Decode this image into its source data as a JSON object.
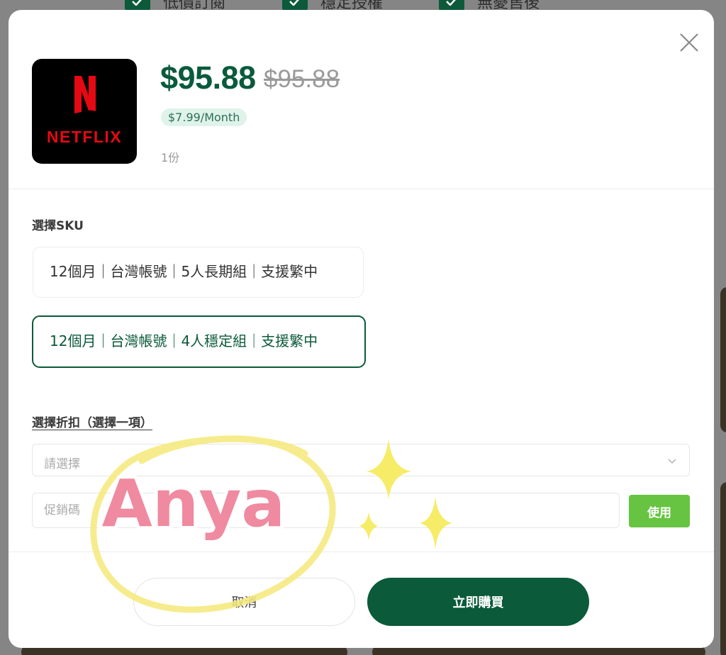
{
  "background": {
    "features": [
      "低價訂閱",
      "穩定授權",
      "無憂售後"
    ]
  },
  "product": {
    "logo_text": "NETFLIX",
    "price": "$95.88",
    "original_price": "$95.88",
    "monthly_price": "$7.99/Month",
    "quantity": "1份"
  },
  "sku": {
    "label": "選擇SKU",
    "options": [
      {
        "label": "12個月｜台灣帳號｜5人長期組｜支援繁中",
        "selected": false
      },
      {
        "label": "12個月｜台灣帳號｜4人穩定組｜支援繁中",
        "selected": true
      }
    ]
  },
  "discount": {
    "label": "選擇折扣（選擇一項）",
    "select_placeholder": "請選擇",
    "promo_placeholder": "促銷碼",
    "use_label": "使用"
  },
  "actions": {
    "cancel_label": "取消",
    "buy_label": "立即購買"
  },
  "overlay": {
    "sticker_text": "Anya"
  },
  "colors": {
    "brand_green": "#0b5a3a",
    "accent_green": "#66c442",
    "netflix_red": "#e50914",
    "sticker_pink": "#e87890",
    "sticker_yellow": "#f5e97a"
  }
}
